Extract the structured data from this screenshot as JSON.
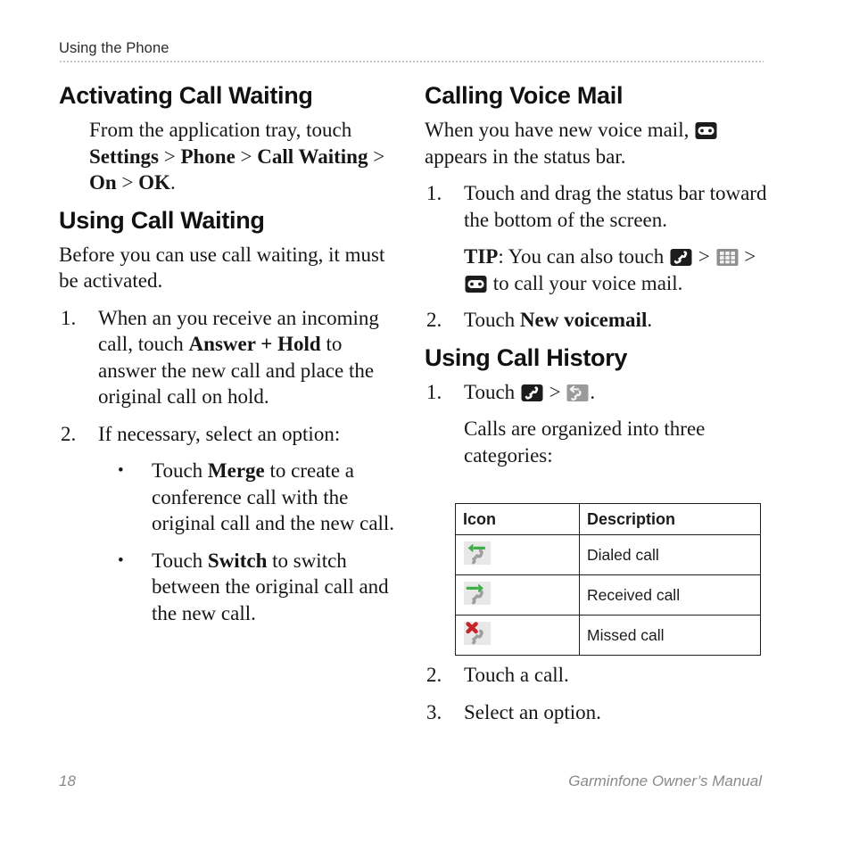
{
  "header": {
    "running_title": "Using the Phone"
  },
  "footer": {
    "page_number": "18",
    "manual_title": "Garminfone Owner’s Manual"
  },
  "colors": {
    "text": "#161616",
    "rule": "#b9b9b9",
    "footer_text": "#8a8a8a",
    "icon_dark": "#1c1c1c",
    "icon_gray": "#9a9a9a",
    "icon_gray_bg": "#e6e6e6",
    "arrow_green": "#3fae49",
    "x_red": "#c9242a",
    "table_border": "#1f1f1f"
  },
  "left_column": {
    "section1": {
      "heading": "Activating Call Waiting",
      "paragraph_parts": [
        {
          "text": "From the application tray, touch ",
          "bold": false
        },
        {
          "text": "Settings",
          "bold": true
        },
        {
          "text": " > ",
          "bold": false
        },
        {
          "text": "Phone",
          "bold": true
        },
        {
          "text": " > ",
          "bold": false
        },
        {
          "text": "Call Waiting",
          "bold": true
        },
        {
          "text": " > ",
          "bold": false
        },
        {
          "text": "On",
          "bold": true
        },
        {
          "text": " > ",
          "bold": false
        },
        {
          "text": "OK",
          "bold": true
        },
        {
          "text": ".",
          "bold": false
        }
      ],
      "paragraph_plain": "From the application tray, touch Settings > Phone > Call Waiting > On > OK."
    },
    "section2": {
      "heading": "Using Call Waiting",
      "intro": "Before you can use call waiting, it must be activated.",
      "steps": [
        {
          "marker": "1.",
          "parts": [
            {
              "text": "When an you receive an incoming call, touch ",
              "bold": false
            },
            {
              "text": "Answer + Hold",
              "bold": true
            },
            {
              "text": " to answer the new call and place the original call on hold.",
              "bold": false
            }
          ]
        },
        {
          "marker": "2.",
          "parts": [
            {
              "text": "If necessary, select an option:",
              "bold": false
            }
          ]
        }
      ],
      "bullets": [
        {
          "marker": "•",
          "parts": [
            {
              "text": "Touch ",
              "bold": false
            },
            {
              "text": "Merge",
              "bold": true
            },
            {
              "text": " to create a conference call with the original call and the new call.",
              "bold": false
            }
          ]
        },
        {
          "marker": "•",
          "parts": [
            {
              "text": "Touch ",
              "bold": false
            },
            {
              "text": "Switch",
              "bold": true
            },
            {
              "text": " to switch between the original call and the new call.",
              "bold": false
            }
          ]
        }
      ]
    }
  },
  "right_column": {
    "section1": {
      "heading": "Calling Voice Mail",
      "intro_before_icon": "When you have new voice mail,",
      "intro_icon": "voicemail-icon",
      "intro_after_icon": "appears in the status bar.",
      "step1": {
        "marker": "1.",
        "text": "Touch and drag the status bar toward the bottom of the screen."
      },
      "tip": {
        "label": "TIP",
        "before": ": You can also touch ",
        "icon1": "phone-handset-icon",
        "sep1": " > ",
        "icon2": "keypad-icon",
        "sep2": " > ",
        "icon3": "voicemail-icon",
        "after": " to call your voice mail."
      },
      "step2": {
        "marker": "2.",
        "before": "Touch ",
        "bold": "New voicemail",
        "after": "."
      }
    },
    "section2": {
      "heading": "Using Call History",
      "step1": {
        "marker": "1.",
        "before": "Touch ",
        "icon1": "phone-handset-icon",
        "sep": " > ",
        "icon2": "call-history-icon",
        "after": "."
      },
      "step1_continuation": "Calls are organized into three categories:",
      "table": {
        "columns": [
          "Icon",
          "Description"
        ],
        "rows": [
          {
            "icon": "dialed-call-icon",
            "description": "Dialed call"
          },
          {
            "icon": "received-call-icon",
            "description": "Received call"
          },
          {
            "icon": "missed-call-icon",
            "description": "Missed call"
          }
        ]
      },
      "step2": {
        "marker": "2.",
        "text": "Touch a call."
      },
      "step3": {
        "marker": "3.",
        "text": "Select an option."
      }
    }
  }
}
